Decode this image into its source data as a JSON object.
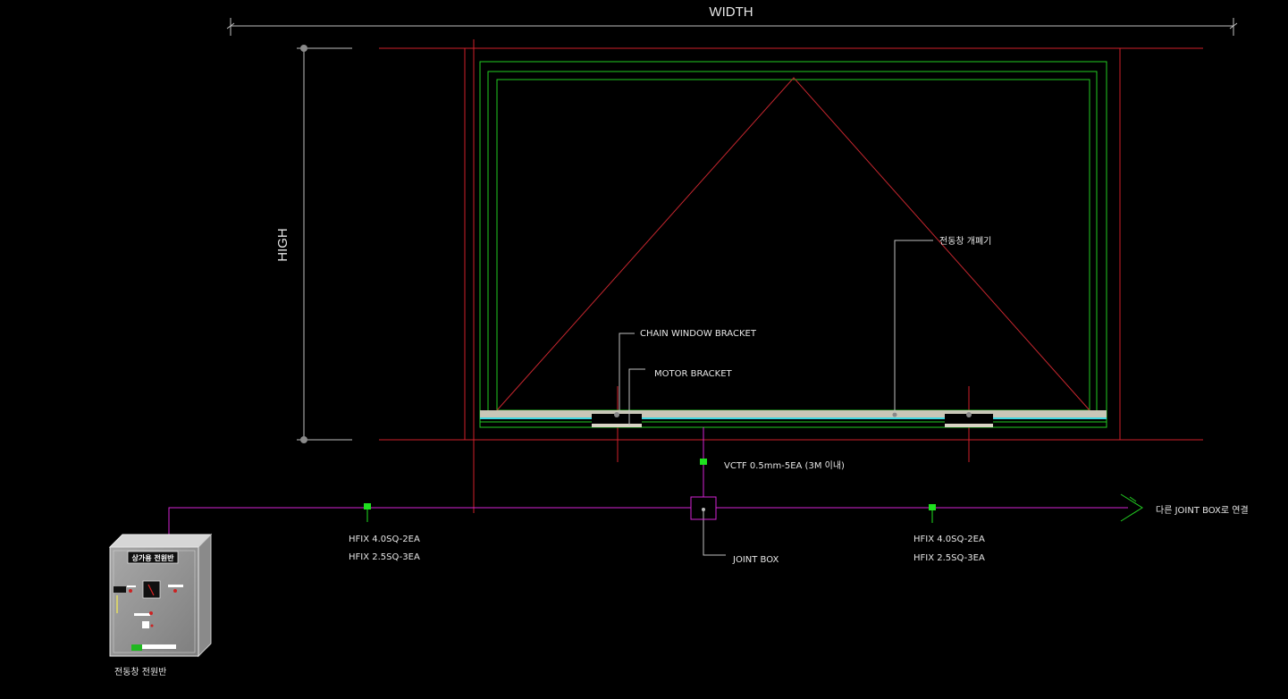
{
  "dimensions": {
    "width_label": "WIDTH",
    "height_label": "HIGH"
  },
  "labels": {
    "actuator": "전동창 개폐기",
    "chain_window_bracket": "CHAIN WINDOW BRACKET",
    "motor_bracket": "MOTOR BRACKET",
    "vctf_cable": "VCTF 0.5mm-5EA (3M 이내)",
    "joint_box": "JOINT BOX",
    "next_joint_box": "다른 JOINT BOX로 연결",
    "power_panel": "전동창 전원반"
  },
  "cable_left": {
    "line1": "HFIX 4.0SQ-2EA",
    "line2": "HFIX 2.5SQ-3EA"
  },
  "cable_right": {
    "line1": "HFIX 4.0SQ-2EA",
    "line2": "HFIX 2.5SQ-3EA"
  },
  "panel": {
    "nameplate": "상가용 전원반"
  },
  "colors": {
    "background": "#000000",
    "frame_green": "#22cc22",
    "guide_red": "#d0202a",
    "wire_magenta": "#d424d4",
    "node_green": "#1fe01f",
    "dimension_gray": "#bfbfbf"
  }
}
